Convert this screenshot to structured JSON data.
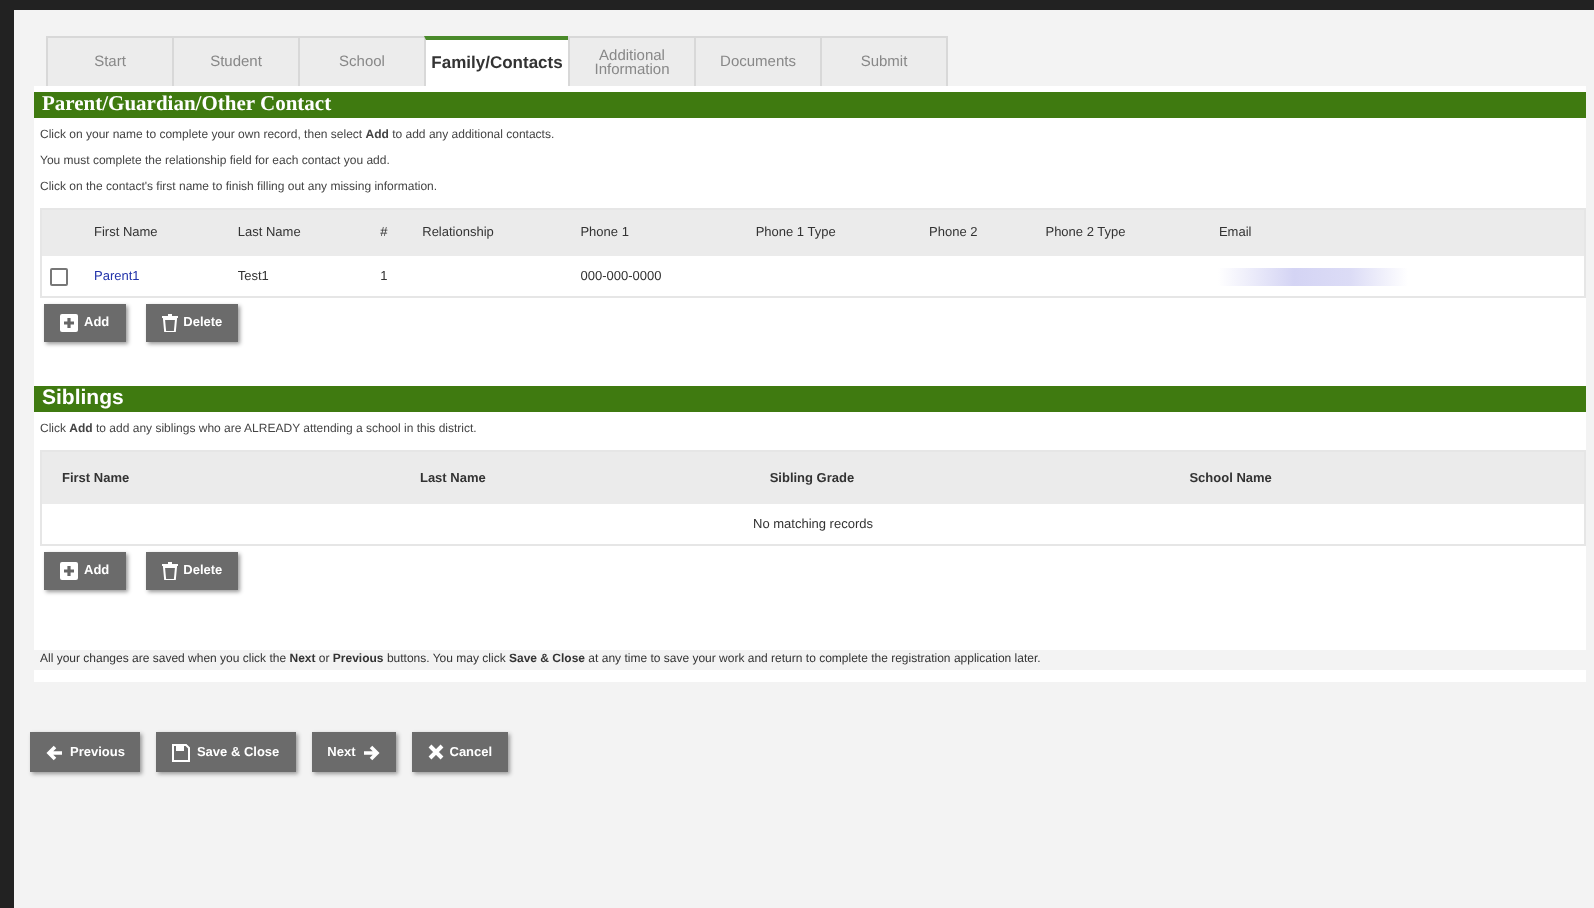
{
  "tabs": [
    {
      "label": "Start",
      "selected": false
    },
    {
      "label": "Student",
      "selected": false
    },
    {
      "label": "School",
      "selected": false
    },
    {
      "label": "Family/Contacts",
      "selected": true
    },
    {
      "label": "Additional Information",
      "selected": false
    },
    {
      "label": "Documents",
      "selected": false
    },
    {
      "label": "Submit",
      "selected": false
    }
  ],
  "contacts": {
    "title": "Parent/Guardian/Other Contact",
    "instructions": [
      "Click on your name to complete your own record, then select **Add** to add any additional contacts.",
      "You must complete the relationship field for each contact you add.",
      "Click on the contact's first name to finish filling out any missing information."
    ],
    "columns": [
      "First Name",
      "Last Name",
      "#",
      "Relationship",
      "Phone 1",
      "Phone 1 Type",
      "Phone 2",
      "Phone 2 Type",
      "Email"
    ],
    "rows": [
      {
        "checked": false,
        "first_name": "Parent1",
        "last_name": "Test1",
        "number": "1",
        "relationship": "",
        "phone_1": "000-000-0000",
        "phone_1_type": "",
        "phone_2": "",
        "phone_2_type": "",
        "email_redacted": true
      }
    ],
    "buttons": [
      {
        "kind": "add",
        "label": "Add"
      },
      {
        "kind": "delete",
        "label": "Delete"
      }
    ]
  },
  "siblings": {
    "title": "Siblings",
    "instructions": [
      "Click **Add** to add any siblings who are ALREADY attending a school in this district."
    ],
    "columns": [
      "First Name",
      "Last Name",
      "Sibling Grade",
      "School Name"
    ],
    "empty_message": "No matching records",
    "buttons": [
      {
        "kind": "add",
        "label": "Add"
      },
      {
        "kind": "delete",
        "label": "Delete"
      }
    ]
  },
  "footer_note": "All your changes are saved when you click the **Next** or **Previous** buttons. You may click **Save & Close** at any time to save your work and return to complete the registration application later.",
  "nav_buttons": [
    {
      "kind": "previous",
      "label": "Previous"
    },
    {
      "kind": "save",
      "label": "Save & Close"
    },
    {
      "kind": "next",
      "label": "Next"
    },
    {
      "kind": "cancel",
      "label": "Cancel"
    }
  ]
}
